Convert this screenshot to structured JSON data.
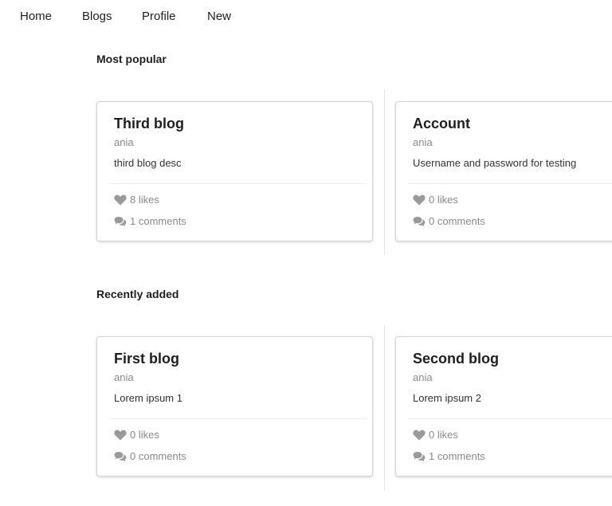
{
  "nav": {
    "items": [
      {
        "label": "Home"
      },
      {
        "label": "Blogs"
      },
      {
        "label": "Profile"
      },
      {
        "label": "New"
      }
    ]
  },
  "sections": [
    {
      "title": "Most popular",
      "cards": [
        {
          "title": "Third blog",
          "author": "ania",
          "description": "third blog desc",
          "likes": "8 likes",
          "comments": "1 comments"
        },
        {
          "title": "Account",
          "author": "ania",
          "description": "Username and password for testing",
          "likes": "0 likes",
          "comments": "0 comments"
        }
      ]
    },
    {
      "title": "Recently added",
      "cards": [
        {
          "title": "First blog",
          "author": "ania",
          "description": "Lorem ipsum 1",
          "likes": "0 likes",
          "comments": "0 comments"
        },
        {
          "title": "Second blog",
          "author": "ania",
          "description": "Lorem ipsum 2",
          "likes": "0 likes",
          "comments": "1 comments"
        }
      ]
    }
  ],
  "icons": {
    "likes": "heart-icon",
    "comments": "comments-icon"
  },
  "colors": {
    "icon": "#9a9a9a",
    "meta_text": "#8a8a8a",
    "card_border": "#d4d4d5"
  }
}
